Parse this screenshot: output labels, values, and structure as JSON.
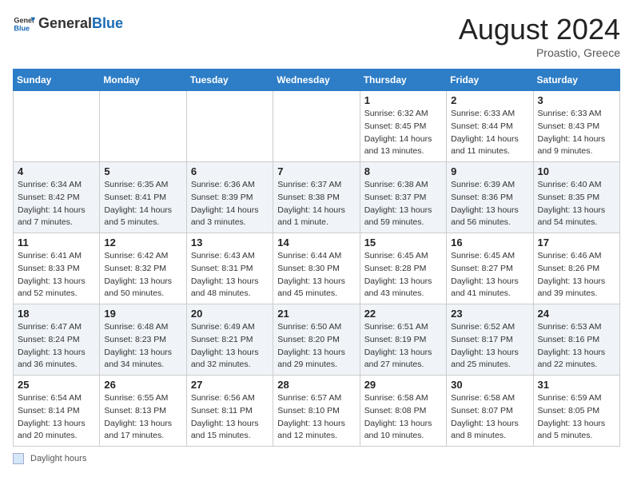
{
  "logo": {
    "text_general": "General",
    "text_blue": "Blue"
  },
  "header": {
    "month_year": "August 2024",
    "location": "Proastio, Greece"
  },
  "weekdays": [
    "Sunday",
    "Monday",
    "Tuesday",
    "Wednesday",
    "Thursday",
    "Friday",
    "Saturday"
  ],
  "weeks": [
    [
      {
        "day": "",
        "detail": ""
      },
      {
        "day": "",
        "detail": ""
      },
      {
        "day": "",
        "detail": ""
      },
      {
        "day": "",
        "detail": ""
      },
      {
        "day": "1",
        "detail": "Sunrise: 6:32 AM\nSunset: 8:45 PM\nDaylight: 14 hours\nand 13 minutes."
      },
      {
        "day": "2",
        "detail": "Sunrise: 6:33 AM\nSunset: 8:44 PM\nDaylight: 14 hours\nand 11 minutes."
      },
      {
        "day": "3",
        "detail": "Sunrise: 6:33 AM\nSunset: 8:43 PM\nDaylight: 14 hours\nand 9 minutes."
      }
    ],
    [
      {
        "day": "4",
        "detail": "Sunrise: 6:34 AM\nSunset: 8:42 PM\nDaylight: 14 hours\nand 7 minutes."
      },
      {
        "day": "5",
        "detail": "Sunrise: 6:35 AM\nSunset: 8:41 PM\nDaylight: 14 hours\nand 5 minutes."
      },
      {
        "day": "6",
        "detail": "Sunrise: 6:36 AM\nSunset: 8:39 PM\nDaylight: 14 hours\nand 3 minutes."
      },
      {
        "day": "7",
        "detail": "Sunrise: 6:37 AM\nSunset: 8:38 PM\nDaylight: 14 hours\nand 1 minute."
      },
      {
        "day": "8",
        "detail": "Sunrise: 6:38 AM\nSunset: 8:37 PM\nDaylight: 13 hours\nand 59 minutes."
      },
      {
        "day": "9",
        "detail": "Sunrise: 6:39 AM\nSunset: 8:36 PM\nDaylight: 13 hours\nand 56 minutes."
      },
      {
        "day": "10",
        "detail": "Sunrise: 6:40 AM\nSunset: 8:35 PM\nDaylight: 13 hours\nand 54 minutes."
      }
    ],
    [
      {
        "day": "11",
        "detail": "Sunrise: 6:41 AM\nSunset: 8:33 PM\nDaylight: 13 hours\nand 52 minutes."
      },
      {
        "day": "12",
        "detail": "Sunrise: 6:42 AM\nSunset: 8:32 PM\nDaylight: 13 hours\nand 50 minutes."
      },
      {
        "day": "13",
        "detail": "Sunrise: 6:43 AM\nSunset: 8:31 PM\nDaylight: 13 hours\nand 48 minutes."
      },
      {
        "day": "14",
        "detail": "Sunrise: 6:44 AM\nSunset: 8:30 PM\nDaylight: 13 hours\nand 45 minutes."
      },
      {
        "day": "15",
        "detail": "Sunrise: 6:45 AM\nSunset: 8:28 PM\nDaylight: 13 hours\nand 43 minutes."
      },
      {
        "day": "16",
        "detail": "Sunrise: 6:45 AM\nSunset: 8:27 PM\nDaylight: 13 hours\nand 41 minutes."
      },
      {
        "day": "17",
        "detail": "Sunrise: 6:46 AM\nSunset: 8:26 PM\nDaylight: 13 hours\nand 39 minutes."
      }
    ],
    [
      {
        "day": "18",
        "detail": "Sunrise: 6:47 AM\nSunset: 8:24 PM\nDaylight: 13 hours\nand 36 minutes."
      },
      {
        "day": "19",
        "detail": "Sunrise: 6:48 AM\nSunset: 8:23 PM\nDaylight: 13 hours\nand 34 minutes."
      },
      {
        "day": "20",
        "detail": "Sunrise: 6:49 AM\nSunset: 8:21 PM\nDaylight: 13 hours\nand 32 minutes."
      },
      {
        "day": "21",
        "detail": "Sunrise: 6:50 AM\nSunset: 8:20 PM\nDaylight: 13 hours\nand 29 minutes."
      },
      {
        "day": "22",
        "detail": "Sunrise: 6:51 AM\nSunset: 8:19 PM\nDaylight: 13 hours\nand 27 minutes."
      },
      {
        "day": "23",
        "detail": "Sunrise: 6:52 AM\nSunset: 8:17 PM\nDaylight: 13 hours\nand 25 minutes."
      },
      {
        "day": "24",
        "detail": "Sunrise: 6:53 AM\nSunset: 8:16 PM\nDaylight: 13 hours\nand 22 minutes."
      }
    ],
    [
      {
        "day": "25",
        "detail": "Sunrise: 6:54 AM\nSunset: 8:14 PM\nDaylight: 13 hours\nand 20 minutes."
      },
      {
        "day": "26",
        "detail": "Sunrise: 6:55 AM\nSunset: 8:13 PM\nDaylight: 13 hours\nand 17 minutes."
      },
      {
        "day": "27",
        "detail": "Sunrise: 6:56 AM\nSunset: 8:11 PM\nDaylight: 13 hours\nand 15 minutes."
      },
      {
        "day": "28",
        "detail": "Sunrise: 6:57 AM\nSunset: 8:10 PM\nDaylight: 13 hours\nand 12 minutes."
      },
      {
        "day": "29",
        "detail": "Sunrise: 6:58 AM\nSunset: 8:08 PM\nDaylight: 13 hours\nand 10 minutes."
      },
      {
        "day": "30",
        "detail": "Sunrise: 6:58 AM\nSunset: 8:07 PM\nDaylight: 13 hours\nand 8 minutes."
      },
      {
        "day": "31",
        "detail": "Sunrise: 6:59 AM\nSunset: 8:05 PM\nDaylight: 13 hours\nand 5 minutes."
      }
    ]
  ],
  "footer": {
    "legend_label": "Daylight hours"
  }
}
